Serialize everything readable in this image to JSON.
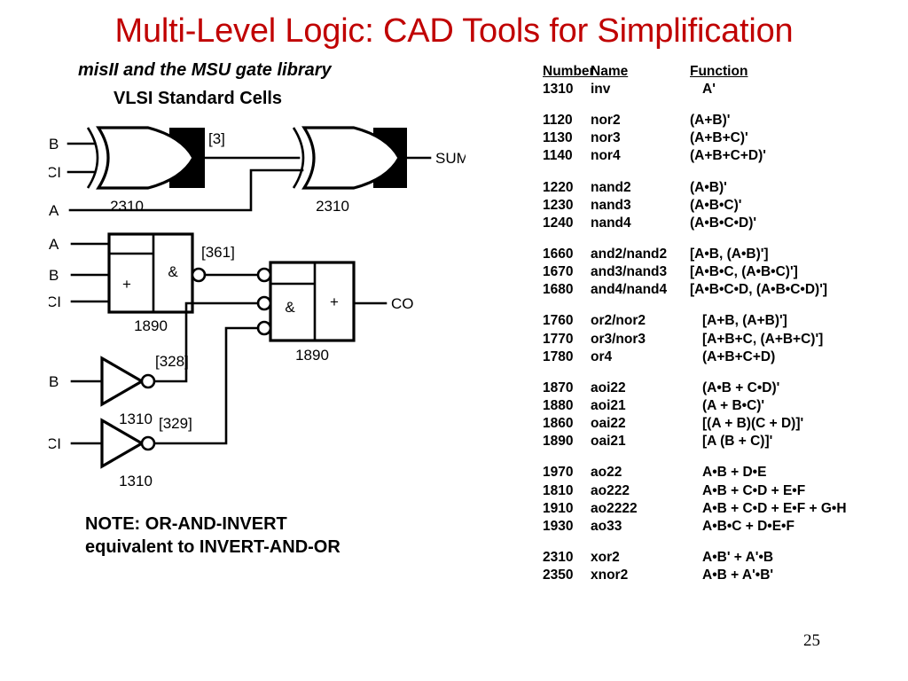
{
  "slide": {
    "title": "Multi-Level Logic: CAD Tools for Simplification",
    "title_color": "#C00000",
    "subtitle_1": "misII and the MSU gate library",
    "subtitle_2": "VLSI Standard Cells",
    "page_number": "25",
    "note": "NOTE: OR-AND-INVERT\nequivalent to INVERT-AND-OR"
  },
  "circuit": {
    "labels": {
      "xor1_in_b": "B",
      "xor1_in_ci": "CI",
      "xor1_cell": "2310",
      "net_3": "[3]",
      "xor2_in_a": "A",
      "xor2_cell": "2310",
      "out_sum": "SUM",
      "oai1_in_a": "A",
      "oai1_in_b": "B",
      "oai1_in_ci": "CI",
      "oai1_or_sym": "+",
      "oai1_and_sym": "&",
      "oai1_cell": "1890",
      "net_361": "[361]",
      "oai2_and_sym": "&",
      "oai2_or_sym": "+",
      "oai2_cell": "1890",
      "out_co": "CO",
      "inv1_in": "B",
      "inv1_net": "[328]",
      "inv1_cell": "1310",
      "inv2_in": "CI",
      "inv2_net": "[329]",
      "inv2_cell": "1310"
    }
  },
  "library_table": {
    "headers": {
      "number": "Number",
      "name": "Name",
      "function": "Function"
    },
    "groups": [
      {
        "rows": [
          {
            "number": "1310",
            "name": "inv",
            "function": "A'",
            "fn_indent": 14
          }
        ]
      },
      {
        "rows": [
          {
            "number": "1120",
            "name": "nor2",
            "function": "(A+B)'",
            "fn_indent": 0
          },
          {
            "number": "1130",
            "name": "nor3",
            "function": "(A+B+C)'",
            "fn_indent": 0
          },
          {
            "number": "1140",
            "name": "nor4",
            "function": "(A+B+C+D)'",
            "fn_indent": 0
          }
        ]
      },
      {
        "rows": [
          {
            "number": "1220",
            "name": "nand2",
            "function": "(A•B)'",
            "fn_indent": 0
          },
          {
            "number": "1230",
            "name": "nand3",
            "function": "(A•B•C)'",
            "fn_indent": 0
          },
          {
            "number": "1240",
            "name": "nand4",
            "function": "(A•B•C•D)'",
            "fn_indent": 0
          }
        ]
      },
      {
        "rows": [
          {
            "number": "1660",
            "name": "and2/nand2",
            "function": "[A•B, (A•B)']",
            "fn_indent": 0
          },
          {
            "number": "1670",
            "name": "and3/nand3",
            "function": "[A•B•C, (A•B•C)']",
            "fn_indent": 0
          },
          {
            "number": "1680",
            "name": "and4/nand4",
            "function": "[A•B•C•D, (A•B•C•D)']",
            "fn_indent": 0
          }
        ]
      },
      {
        "rows": [
          {
            "number": "1760",
            "name": "or2/nor2",
            "function": "[A+B, (A+B)']",
            "fn_indent": 14
          },
          {
            "number": "1770",
            "name": "or3/nor3",
            "function": "[A+B+C, (A+B+C)']",
            "fn_indent": 14
          },
          {
            "number": "1780",
            "name": "or4",
            "function": "(A+B+C+D)",
            "fn_indent": 14
          }
        ]
      },
      {
        "rows": [
          {
            "number": "1870",
            "name": "aoi22",
            "function": "(A•B + C•D)'",
            "fn_indent": 14
          },
          {
            "number": "1880",
            "name": "aoi21",
            "function": "(A + B•C)'",
            "fn_indent": 14
          },
          {
            "number": "1860",
            "name": "oai22",
            "function": "[(A + B)(C + D)]'",
            "fn_indent": 14
          },
          {
            "number": "1890",
            "name": "oai21",
            "function": "[A (B + C)]'",
            "fn_indent": 14
          }
        ]
      },
      {
        "rows": [
          {
            "number": "1970",
            "name": "ao22",
            "function": "A•B + D•E",
            "fn_indent": 14
          },
          {
            "number": "1810",
            "name": "ao222",
            "function": "A•B + C•D + E•F",
            "fn_indent": 14
          },
          {
            "number": "1910",
            "name": "ao2222",
            "function": "A•B + C•D + E•F + G•H",
            "fn_indent": 14
          },
          {
            "number": "1930",
            "name": "ao33",
            "function": "A•B•C + D•E•F",
            "fn_indent": 14
          }
        ]
      },
      {
        "rows": [
          {
            "number": "2310",
            "name": "xor2",
            "function": "A•B' + A'•B",
            "fn_indent": 14
          },
          {
            "number": "2350",
            "name": "xnor2",
            "function": "A•B + A'•B'",
            "fn_indent": 14
          }
        ]
      }
    ]
  }
}
